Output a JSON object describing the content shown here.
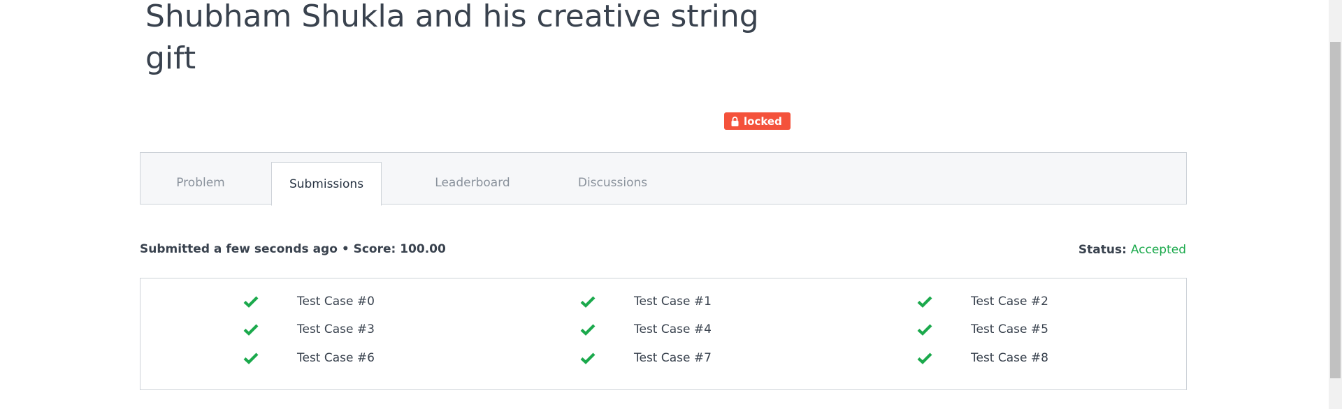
{
  "challenge": {
    "title": "Shubham Shukla and his creative string gift",
    "badge": {
      "label": "locked",
      "icon": "lock-icon",
      "color": "#f4523b"
    }
  },
  "tabs": [
    {
      "label": "Problem",
      "active": false
    },
    {
      "label": "Submissions",
      "active": true
    },
    {
      "label": "Leaderboard",
      "active": false
    },
    {
      "label": "Discussions",
      "active": false
    }
  ],
  "submission": {
    "summary": "Submitted a few seconds ago • Score: 100.00",
    "status_label": "Status:",
    "status_value": "Accepted",
    "status_color": "#1ba94c"
  },
  "test_cases": [
    {
      "label": "Test Case #0",
      "icon": "check-icon",
      "passed": true
    },
    {
      "label": "Test Case #1",
      "icon": "check-icon",
      "passed": true
    },
    {
      "label": "Test Case #2",
      "icon": "check-icon",
      "passed": true
    },
    {
      "label": "Test Case #3",
      "icon": "check-icon",
      "passed": true
    },
    {
      "label": "Test Case #4",
      "icon": "check-icon",
      "passed": true
    },
    {
      "label": "Test Case #5",
      "icon": "check-icon",
      "passed": true
    },
    {
      "label": "Test Case #6",
      "icon": "check-icon",
      "passed": true
    },
    {
      "label": "Test Case #7",
      "icon": "check-icon",
      "passed": true
    },
    {
      "label": "Test Case #8",
      "icon": "check-icon",
      "passed": true
    }
  ]
}
